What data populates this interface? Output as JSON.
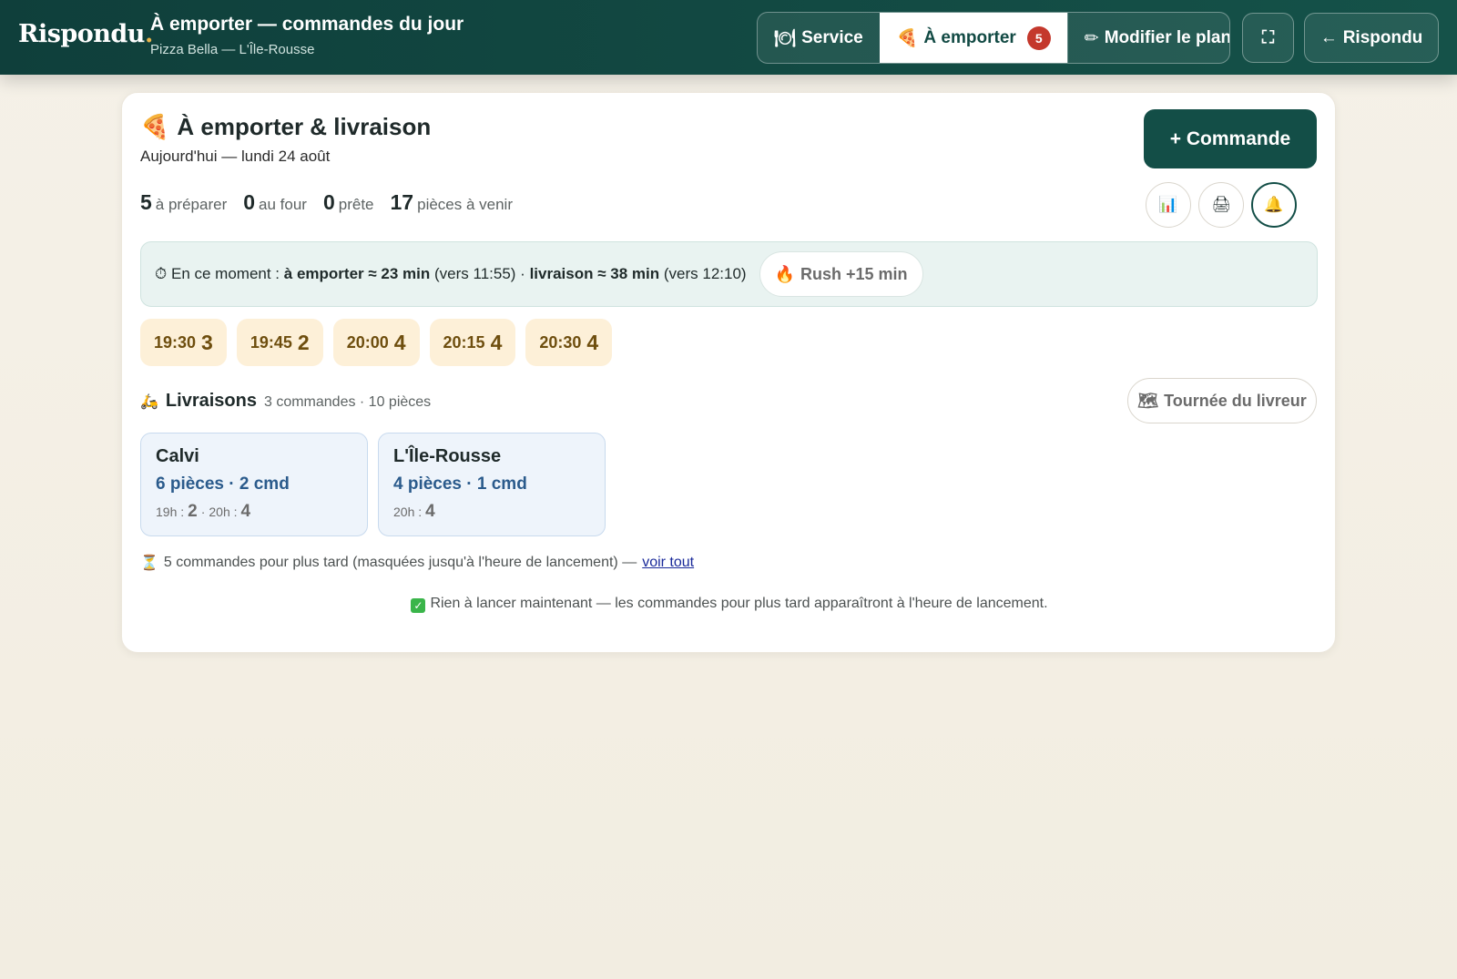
{
  "header": {
    "brand": "Rispondu",
    "brand_dot": ".",
    "title": "À emporter — commandes du jour",
    "subtitle": "Pizza Bella — L'Île-Rousse",
    "tabs": [
      {
        "label": "Service",
        "icon": "plate-icon",
        "glyph": "🍽"
      },
      {
        "label": "À emporter",
        "icon": "pizza-icon",
        "glyph": "🍕",
        "badge": "5"
      },
      {
        "label": "Modifier le plan",
        "icon": "pencil-icon",
        "glyph": "✏"
      }
    ],
    "fullscreen_glyph": "⛶",
    "back_label": "Rispondu",
    "back_glyph": "←"
  },
  "card": {
    "title": "À emporter & livraison",
    "title_glyph": "🍕",
    "date": "Aujourd'hui — lundi 24 août",
    "new_order": "+ Commande",
    "stats": [
      {
        "num": "5",
        "label": "à préparer"
      },
      {
        "num": "0",
        "label": "au four"
      },
      {
        "num": "0",
        "label": "prête"
      },
      {
        "num": "17",
        "label": "pièces à venir"
      }
    ],
    "round_buttons": [
      {
        "name": "stats-icon",
        "glyph": "📊"
      },
      {
        "name": "printer-icon",
        "glyph": "🖨"
      },
      {
        "name": "bell-icon",
        "glyph": "🔔"
      }
    ],
    "now": {
      "prefix": "⏱ En ce moment :",
      "takeaway": "à emporter ≈ 23 min",
      "takeaway_time": "(vers 11:55) ·",
      "delivery": "livraison ≈ 38 min",
      "delivery_time": "(vers 12:10)",
      "rush_glyph": "🔥",
      "rush_label": "Rush +15 min"
    },
    "slots": [
      {
        "time": "19:30",
        "count": "3"
      },
      {
        "time": "19:45",
        "count": "2"
      },
      {
        "time": "20:00",
        "count": "4"
      },
      {
        "time": "20:15",
        "count": "4"
      },
      {
        "time": "20:30",
        "count": "4"
      }
    ],
    "deliveries": {
      "glyph": "🛵",
      "title": "Livraisons",
      "meta": "3 commandes · 10 pièces",
      "tour_glyph": "🗺",
      "tour_label": "Tournée du livreur",
      "towns": [
        {
          "name": "Calvi",
          "summary": "6 pièces · 2 cmd",
          "breakdown": [
            {
              "label": "19h :",
              "value": "2",
              "sep": "·"
            },
            {
              "label": "20h :",
              "value": "4",
              "sep": ""
            }
          ]
        },
        {
          "name": "L'Île-Rousse",
          "summary": "4 pièces · 1 cmd",
          "breakdown": [
            {
              "label": "20h :",
              "value": "4",
              "sep": ""
            }
          ]
        }
      ]
    },
    "later": {
      "glyph": "⏳",
      "text": "5 commandes pour plus tard (masquées jusqu'à l'heure de lancement) —",
      "link": "voir tout"
    },
    "nothing": {
      "glyph": "✓",
      "text": "Rien à lancer maintenant — les commandes pour plus tard apparaîtront à l'heure de lancement."
    }
  }
}
